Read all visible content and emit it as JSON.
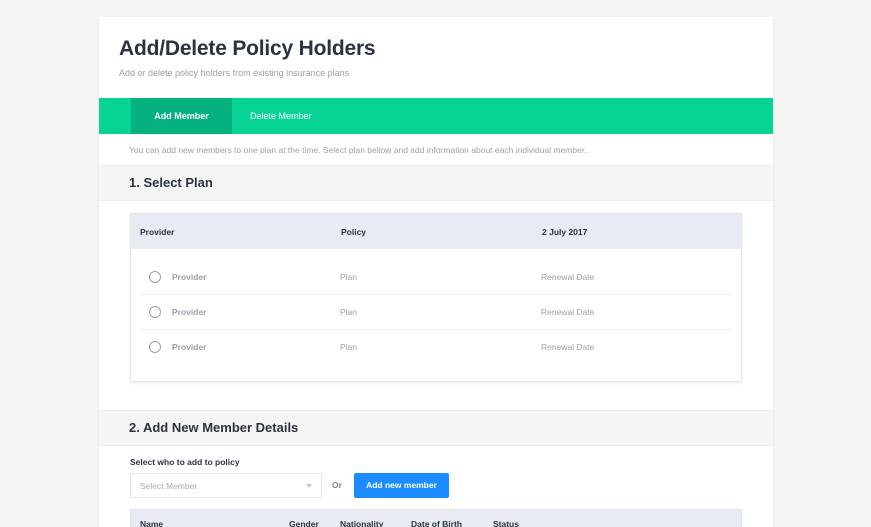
{
  "header": {
    "title": "Add/Delete Policy Holders",
    "subtitle": "Add or delete policy holders from existing insurance plans"
  },
  "tabs": [
    {
      "label": "Add Member",
      "active": true
    },
    {
      "label": "Delete Member",
      "active": false
    }
  ],
  "info": "You can add new members to one plan at the time. Select plan bellow and add information about each individual member.",
  "section1": {
    "title": "1. Select Plan",
    "columns": [
      "Provider",
      "Policy",
      "2 July 2017"
    ],
    "rows": [
      {
        "provider": "Provider",
        "policy": "Plan",
        "renewal": "Renewal Date"
      },
      {
        "provider": "Provider",
        "policy": "Plan",
        "renewal": "Renewal Date"
      },
      {
        "provider": "Provider",
        "policy": "Plan",
        "renewal": "Renewal Date"
      }
    ]
  },
  "section2": {
    "title": "2. Add New Member Details",
    "select_label": "Select who to add to policy",
    "select_placeholder": "Select Member",
    "or_text": "Or",
    "add_button": "Add new member",
    "columns": [
      "Name",
      "Gender",
      "Nationality",
      "Date of Birth",
      "Status"
    ]
  },
  "colors": {
    "accent_green": "#07d494",
    "active_tab": "#05b17f",
    "button_blue": "#1a8cff"
  }
}
